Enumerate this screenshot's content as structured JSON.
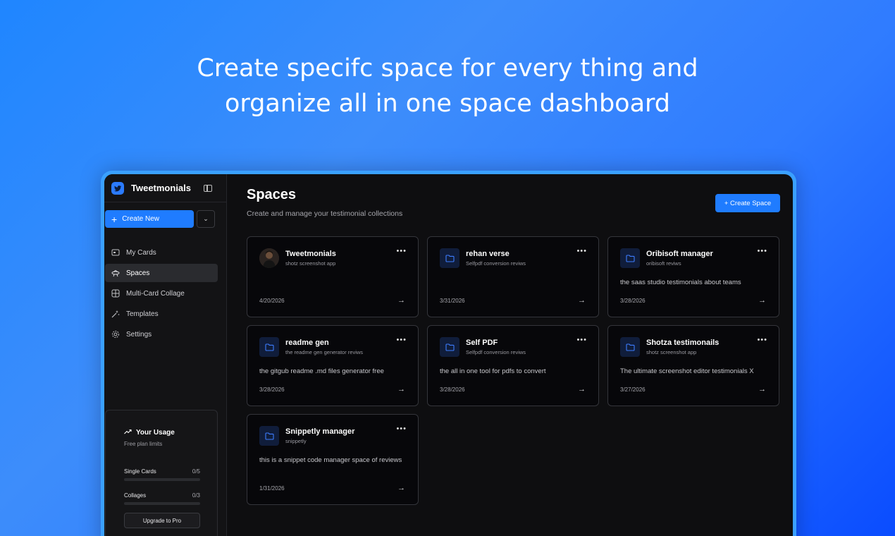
{
  "headline": {
    "line1": "Create specifc space for every thing and",
    "line2": "organize all in one space dashboard"
  },
  "sidebar": {
    "brand": "Tweetmonials",
    "create_new": "Create New",
    "items": [
      {
        "label": "My Cards",
        "icon": "card-icon"
      },
      {
        "label": "Spaces",
        "icon": "ufo-icon",
        "active": true
      },
      {
        "label": "Multi-Card Collage",
        "icon": "collage-icon"
      },
      {
        "label": "Templates",
        "icon": "sparkles-icon"
      },
      {
        "label": "Settings",
        "icon": "gear-icon"
      }
    ],
    "usage": {
      "title": "Your Usage",
      "subtitle": "Free plan limits",
      "single_label": "Single Cards",
      "single_count": "0/5",
      "collage_label": "Collages",
      "collage_count": "0/3",
      "upgrade": "Upgrade to Pro"
    }
  },
  "main": {
    "title": "Spaces",
    "subtitle": "Create and manage your testimonial collections",
    "create_space": "+ Create Space",
    "cards": [
      {
        "name": "Tweetmonials",
        "tag": "shotz screenshot app",
        "desc": "",
        "date": "4/20/2026",
        "avatar": true
      },
      {
        "name": "rehan verse",
        "tag": "Selfpdf conversion reviws",
        "desc": "",
        "date": "3/31/2026"
      },
      {
        "name": "Oribisoft manager",
        "tag": "oribisoft reviws",
        "desc": "the saas studio testimonials about teams",
        "date": "3/28/2026"
      },
      {
        "name": "readme gen",
        "tag": "the readme gen generator reviws",
        "desc": "the gitgub readme .md files generator free",
        "date": "3/28/2026"
      },
      {
        "name": "Self PDF",
        "tag": "Selfpdf conversion reviws",
        "desc": "the all in one tool for pdfs to convert",
        "date": "3/28/2026"
      },
      {
        "name": "Shotza testimonails",
        "tag": "shotz screenshot app",
        "desc": "The ultimate screenshot editor testimonials X",
        "date": "3/27/2026"
      },
      {
        "name": "Snippetly manager",
        "tag": "snippetly",
        "desc": "this is a snippet code manager space of reviews",
        "date": "1/31/2026"
      }
    ]
  },
  "colors": {
    "accent": "#1f7cff",
    "background": "#0e0e10",
    "card_border": "#34353b"
  }
}
